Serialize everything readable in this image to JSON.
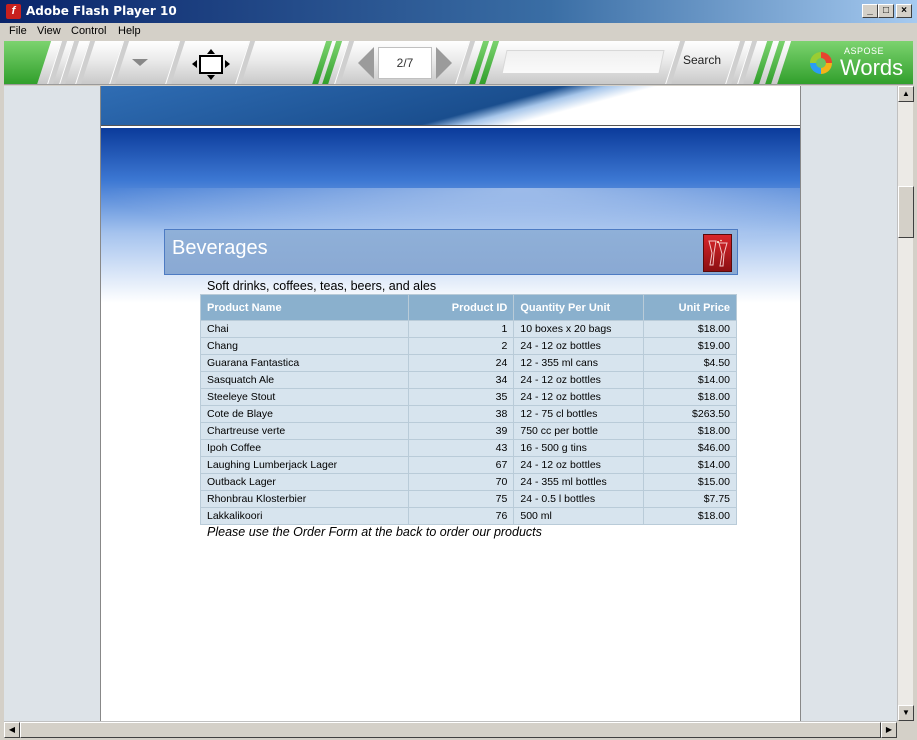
{
  "window": {
    "title": "Adobe Flash Player 10",
    "minimize": "_",
    "maximize": "□",
    "close": "×"
  },
  "menu": [
    "File",
    "View",
    "Control",
    "Help"
  ],
  "toolbar": {
    "page_indicator": "2/7",
    "search_placeholder": "",
    "search_label": "Search",
    "logo_top": "ASPOSE",
    "logo_main": "Words",
    "accent_green": "#3faa35"
  },
  "document": {
    "category_title": "Beverages",
    "category_description": "Soft drinks, coffees, teas, beers, and ales",
    "columns": [
      "Product Name",
      "Product ID",
      "Quantity Per Unit",
      "Unit Price"
    ],
    "rows": [
      [
        "Chai",
        "1",
        "10 boxes x 20 bags",
        "$18.00"
      ],
      [
        "Chang",
        "2",
        "24 - 12 oz bottles",
        "$19.00"
      ],
      [
        "Guarana Fantastica",
        "24",
        "12 - 355 ml cans",
        "$4.50"
      ],
      [
        "Sasquatch Ale",
        "34",
        "24 - 12 oz bottles",
        "$14.00"
      ],
      [
        "Steeleye Stout",
        "35",
        "24 - 12 oz bottles",
        "$18.00"
      ],
      [
        "Cote de Blaye",
        "38",
        "12 - 75 cl bottles",
        "$263.50"
      ],
      [
        "Chartreuse verte",
        "39",
        "750 cc per bottle",
        "$18.00"
      ],
      [
        "Ipoh Coffee",
        "43",
        "16 - 500 g tins",
        "$46.00"
      ],
      [
        "Laughing Lumberjack Lager",
        "67",
        "24 - 12 oz bottles",
        "$14.00"
      ],
      [
        "Outback Lager",
        "70",
        "24 - 355 ml bottles",
        "$15.00"
      ],
      [
        "Rhonbrau Klosterbier",
        "75",
        "24 - 0.5 l bottles",
        "$7.75"
      ],
      [
        "Lakkalikoori",
        "76",
        "500 ml",
        "$18.00"
      ]
    ],
    "footer_note": "Please use the Order Form at the back to order our products"
  },
  "scrollbar": {
    "up": "▲",
    "down": "▼",
    "left": "◀",
    "right": "▶"
  }
}
